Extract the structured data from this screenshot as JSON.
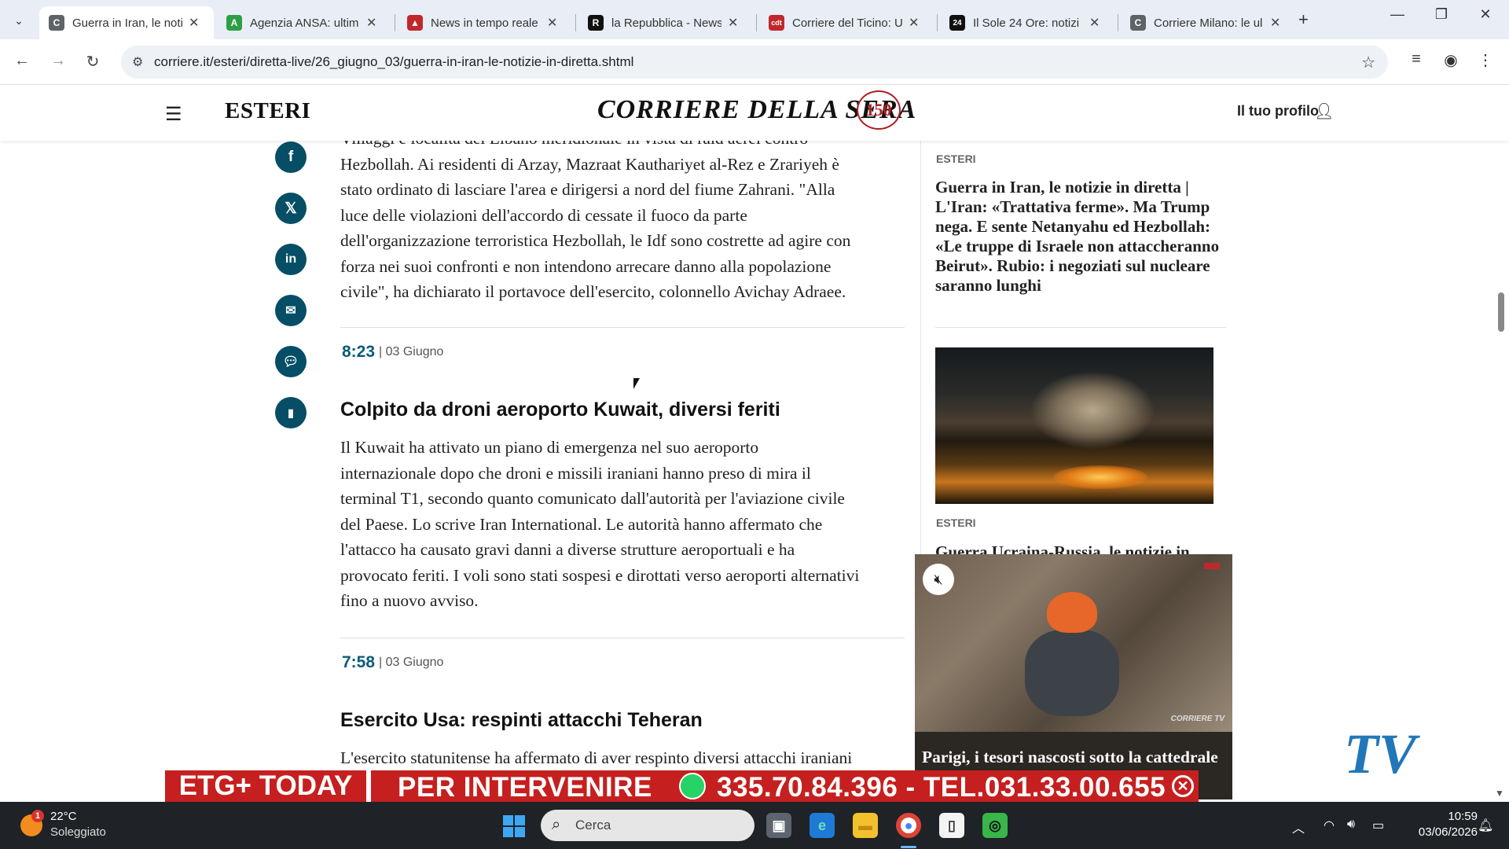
{
  "browser": {
    "tabs": [
      {
        "title": "Guerra in Iran, le noti",
        "favicon": "C",
        "color": "#ffffff",
        "fav_bg": "#5f6368"
      },
      {
        "title": "Agenzia ANSA: ultim",
        "favicon": "A",
        "color": "#e9eef6",
        "fav_bg": "#2e9e44"
      },
      {
        "title": "News in tempo reale",
        "favicon": "▲",
        "color": "#e9eef6",
        "fav_bg": "#c0282d"
      },
      {
        "title": "la Repubblica - News",
        "favicon": "R",
        "color": "#e9eef6",
        "fav_bg": "#111111"
      },
      {
        "title": "Corriere del Ticino: U",
        "favicon": "cdt",
        "color": "#e9eef6",
        "fav_bg": "#c0282d"
      },
      {
        "title": "Il Sole 24 Ore: notizi",
        "favicon": "24",
        "color": "#e9eef6",
        "fav_bg": "#111111"
      },
      {
        "title": "Corriere Milano: le ul",
        "favicon": "C",
        "color": "#e9eef6",
        "fav_bg": "#5f6368"
      }
    ],
    "url": "corriere.it/esteri/diretta-live/26_giugno_03/guerra-in-iran-le-notizie-in-diretta.shtml"
  },
  "site": {
    "section": "ESTERI",
    "logo": "CORRIERE DELLA SERA",
    "logo_badge": "150",
    "profile": "Il tuo profilo"
  },
  "article": {
    "intro_lines": [
      "Villaggi e località del Libano meridionale in vista di raid aerei contro",
      "Hezbollah. Ai residenti di Arzay, Mazraat Kauthariyet al-Rez e Zrariyeh è",
      "stato ordinato di lasciare l'area e dirigersi a nord del fiume Zahrani. \"Alla",
      "luce delle violazioni dell'accordo di cessate il fuoco da parte",
      "dell'organizzazione terroristica Hezbollah, le Idf sono costrette ad agire con",
      "forza nei suoi confronti e non intendono arrecare danno alla popolazione",
      "civile\", ha dichiarato il portavoce dell'esercito, colonnello Avichay Adraee."
    ],
    "entries": [
      {
        "time": "8:23",
        "date": "| 03 Giugno",
        "title": "Colpito da droni aeroporto Kuwait, diversi feriti",
        "lines": [
          "Il Kuwait ha attivato un piano di emergenza nel suo aeroporto",
          "internazionale dopo che droni e missili iraniani hanno preso di mira il",
          "terminal T1, secondo quanto comunicato dall'autorità per l'aviazione civile",
          "del Paese. Lo scrive Iran International. Le autorità hanno affermato che",
          "l'attacco ha causato gravi danni a diverse strutture aeroportuali e ha",
          "provocato feriti. I voli sono stati sospesi e dirottati verso aeroporti alternativi",
          "fino a nuovo avviso."
        ]
      },
      {
        "time": "7:58",
        "date": "| 03 Giugno",
        "title": "Esercito Usa: respinti attacchi Teheran",
        "lines": [
          "L'esercito statunitense ha affermato di aver respinto diversi attacchi iraniani"
        ]
      }
    ]
  },
  "sidebar": {
    "items": [
      {
        "kicker": "ESTERI",
        "title": "Guerra in Iran, le notizie in diretta | L'Iran: «Trattativa ferme». Ma Trump nega. E sente Netanyahu ed Hezbollah: «Le truppe di Israele non attaccheranno Beirut». Rubio: i negoziati sul nucleare saranno lunghi"
      },
      {
        "kicker": "ESTERI",
        "title": "Guerra Ucraina-Russia, le notizie in"
      }
    ]
  },
  "video": {
    "brand": "CORRIERE TV",
    "caption": "Parigi, i tesori nascosti sotto la cattedrale"
  },
  "ticker": {
    "brand": "ETG+ TODAY",
    "message_prefix": "PER INTERVENIRE",
    "message_numbers": "335.70.84.396 - TEL.031.33.00.655"
  },
  "watermark": "TV",
  "taskbar": {
    "weather_badge": "1",
    "temperature": "22°C",
    "weather": "Soleggiato",
    "search_placeholder": "Cerca",
    "time": "10:59",
    "date": "03/06/2026"
  }
}
